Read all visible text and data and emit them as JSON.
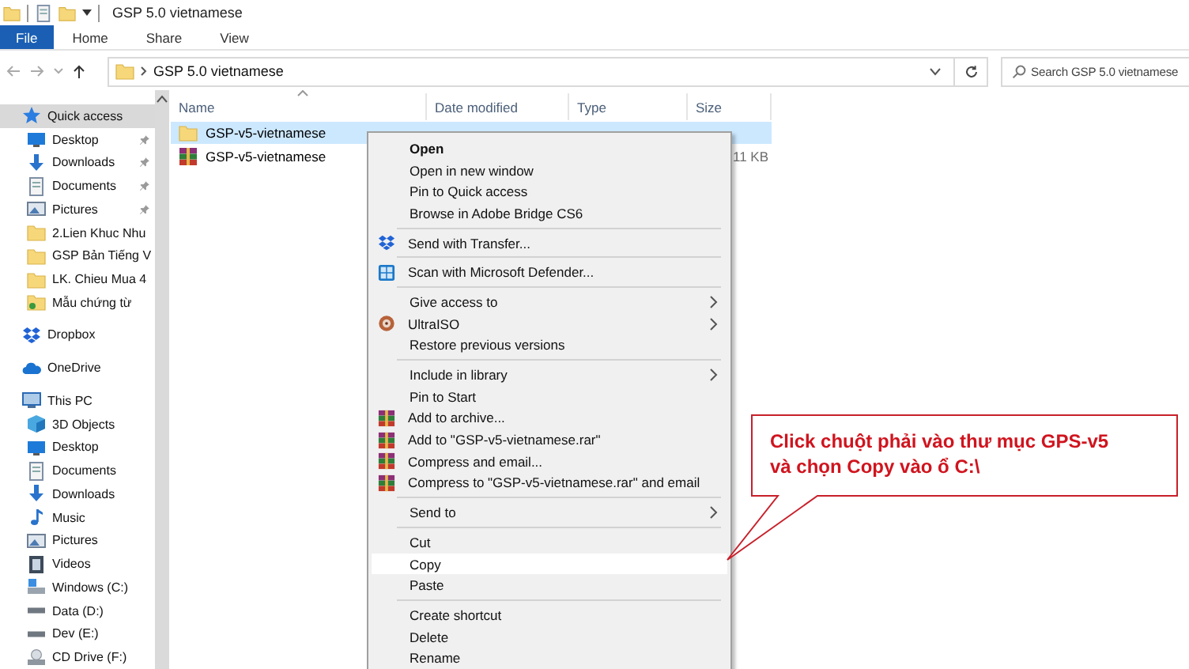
{
  "window": {
    "title": "GSP 5.0 vietnamese"
  },
  "ribbon_tabs": [
    {
      "label": "File",
      "kind": "file"
    },
    {
      "label": "Home",
      "kind": "tab"
    },
    {
      "label": "Share",
      "kind": "tab"
    },
    {
      "label": "View",
      "kind": "tab"
    }
  ],
  "address_bar": {
    "path": "GSP 5.0 vietnamese"
  },
  "search": {
    "placeholder": "Search GSP 5.0 vietnamese"
  },
  "navigation_pane": {
    "items": [
      {
        "label": "Quick access",
        "kind": "star",
        "selected": true,
        "children": [
          {
            "label": "Desktop",
            "kind": "desktop",
            "pinned": true,
            "selected": false
          },
          {
            "label": "Downloads",
            "kind": "download",
            "pinned": true,
            "selected": false
          },
          {
            "label": "Documents",
            "kind": "document",
            "pinned": true,
            "selected": false
          },
          {
            "label": "Pictures",
            "kind": "picture",
            "pinned": true,
            "selected": false
          },
          {
            "label": "2.Lien Khuc Nhu",
            "kind": "folder",
            "selected": false
          },
          {
            "label": "GSP Bản Tiếng V",
            "kind": "folder",
            "selected": false
          },
          {
            "label": "LK. Chieu Mua 4",
            "kind": "folder",
            "selected": false
          },
          {
            "label": "Mẫu chứng từ",
            "kind": "photofolder",
            "selected": false
          }
        ]
      },
      {
        "label": "Dropbox",
        "kind": "dropbox",
        "selected": false
      },
      {
        "label": "OneDrive",
        "kind": "cloud",
        "selected": false
      },
      {
        "label": "This PC",
        "kind": "computer",
        "selected": false,
        "children": [
          {
            "label": "3D Objects",
            "kind": "cube",
            "selected": false
          },
          {
            "label": "Desktop",
            "kind": "desktop",
            "selected": false
          },
          {
            "label": "Documents",
            "kind": "document",
            "selected": false
          },
          {
            "label": "Downloads",
            "kind": "download",
            "selected": false
          },
          {
            "label": "Music",
            "kind": "music",
            "selected": false
          },
          {
            "label": "Pictures",
            "kind": "picture",
            "selected": false
          },
          {
            "label": "Videos",
            "kind": "video",
            "selected": false
          },
          {
            "label": "Windows (C:)",
            "kind": "systemdrive",
            "selected": false
          },
          {
            "label": "Data (D:)",
            "kind": "drive",
            "selected": false
          },
          {
            "label": "Dev (E:)",
            "kind": "drive",
            "selected": false
          },
          {
            "label": "CD Drive (F:)",
            "kind": "disc",
            "selected": false
          }
        ]
      }
    ]
  },
  "file_list": {
    "columns": [
      "Name",
      "Date modified",
      "Type",
      "Size"
    ],
    "rows": [
      {
        "name": "GSP-v5-vietnamese",
        "kind": "folder",
        "selected": true
      },
      {
        "name": "GSP-v5-vietnamese",
        "kind": "archive",
        "size": "11 KB",
        "selected": false
      }
    ]
  },
  "context_menu": {
    "items": [
      {
        "kind": "text",
        "label": "Open",
        "bold": true,
        "submenu": false,
        "selected": false
      },
      {
        "kind": "text",
        "label": "Open in new window",
        "bold": false,
        "submenu": false,
        "selected": false
      },
      {
        "kind": "text",
        "label": "Pin to Quick access",
        "bold": false,
        "submenu": false,
        "selected": false
      },
      {
        "kind": "text",
        "label": "Browse in Adobe Bridge CS6",
        "bold": false,
        "submenu": false,
        "selected": false
      },
      {
        "kind": "separator"
      },
      {
        "kind": "dropbox",
        "label": "Send with Transfer...",
        "bold": false,
        "submenu": false,
        "selected": false
      },
      {
        "kind": "separator"
      },
      {
        "kind": "shield",
        "label": "Scan with Microsoft Defender...",
        "bold": false,
        "submenu": false,
        "selected": false
      },
      {
        "kind": "separator"
      },
      {
        "kind": "text",
        "label": "Give access to",
        "bold": false,
        "submenu": true,
        "selected": false
      },
      {
        "kind": "disc",
        "label": "UltraISO",
        "bold": false,
        "submenu": true,
        "selected": false
      },
      {
        "kind": "text",
        "label": "Restore previous versions",
        "bold": false,
        "submenu": false,
        "selected": false
      },
      {
        "kind": "separator"
      },
      {
        "kind": "text",
        "label": "Include in library",
        "bold": false,
        "submenu": true,
        "selected": false
      },
      {
        "kind": "text",
        "label": "Pin to Start",
        "bold": false,
        "submenu": false,
        "selected": false
      },
      {
        "kind": "archive",
        "label": "Add to archive...",
        "bold": false,
        "submenu": false,
        "selected": false
      },
      {
        "kind": "archive",
        "label": "Add to \"GSP-v5-vietnamese.rar\"",
        "bold": false,
        "submenu": false,
        "selected": false
      },
      {
        "kind": "archive",
        "label": "Compress and email...",
        "bold": false,
        "submenu": false,
        "selected": false
      },
      {
        "kind": "archive",
        "label": "Compress to \"GSP-v5-vietnamese.rar\" and email",
        "bold": false,
        "submenu": false,
        "selected": false
      },
      {
        "kind": "separator"
      },
      {
        "kind": "text",
        "label": "Send to",
        "bold": false,
        "submenu": true,
        "selected": false
      },
      {
        "kind": "separator"
      },
      {
        "kind": "text",
        "label": "Cut",
        "bold": false,
        "submenu": false,
        "selected": false
      },
      {
        "kind": "text",
        "label": "Copy",
        "bold": false,
        "submenu": false,
        "selected": true
      },
      {
        "kind": "text",
        "label": "Paste",
        "bold": false,
        "submenu": false,
        "selected": false
      },
      {
        "kind": "separator"
      },
      {
        "kind": "text",
        "label": "Create shortcut",
        "bold": false,
        "submenu": false,
        "selected": false
      },
      {
        "kind": "text",
        "label": "Delete",
        "bold": false,
        "submenu": false,
        "selected": false
      },
      {
        "kind": "text",
        "label": "Rename",
        "bold": false,
        "submenu": false,
        "selected": false
      }
    ]
  },
  "callout": {
    "lines": [
      "Click chuột phải vào thư mục GPS-v5",
      "và chọn Copy vào ổ C:\\"
    ]
  }
}
